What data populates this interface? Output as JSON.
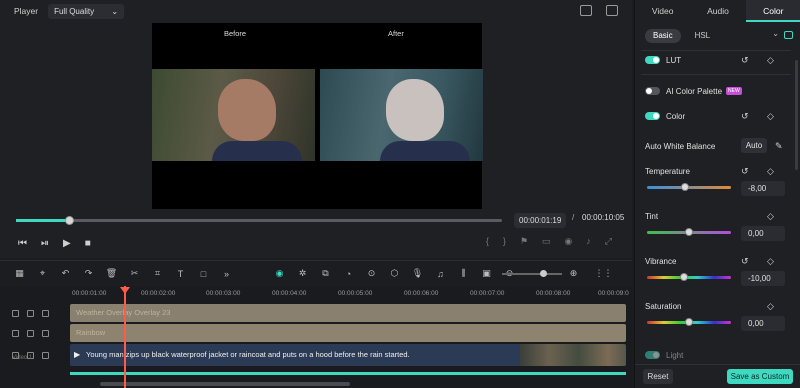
{
  "player": {
    "label": "Player",
    "quality": "Full Quality",
    "before_label": "Before",
    "after_label": "After",
    "progress": 0.11,
    "current_time": "00:00:01:19",
    "separator": "/",
    "total_time": "00:00:10:05"
  },
  "panel": {
    "tabs": [
      "Video",
      "Audio",
      "Color"
    ],
    "active_tab": "Color",
    "subtabs": [
      "Basic",
      "HSL"
    ],
    "active_subtab": "Basic",
    "lut": "LUT",
    "ai_palette": "AI Color Palette",
    "new_badge": "NEW",
    "color": "Color",
    "awb": "Auto White Balance",
    "auto": "Auto",
    "temperature": {
      "label": "Temperature",
      "value": "-8,00",
      "position": 0.45
    },
    "tint": {
      "label": "Tint",
      "value": "0,00",
      "position": 0.5
    },
    "vibrance": {
      "label": "Vibrance",
      "value": "-10,00",
      "position": 0.44
    },
    "saturation": {
      "label": "Saturation",
      "value": "0,00",
      "position": 0.5
    },
    "light": "Light",
    "reset": "Reset",
    "save_as_custom": "Save as Custom",
    "accent": "#3fd9c1"
  },
  "timeline": {
    "ruler": [
      "00:00:01:00",
      "00:00:02:00",
      "00:00:03:00",
      "00:00:04:00",
      "00:00:05:00",
      "00:00:06:00",
      "00:00:07:00",
      "00:00:08:00",
      "00:00:09:0"
    ],
    "effect1": "Weather Overlay Overlay 23",
    "effect2": "Rainbow",
    "video_clip": "Young man zips up black waterproof jacket or raincoat and puts on a hood before the rain started.",
    "track_label": "Video 1"
  }
}
